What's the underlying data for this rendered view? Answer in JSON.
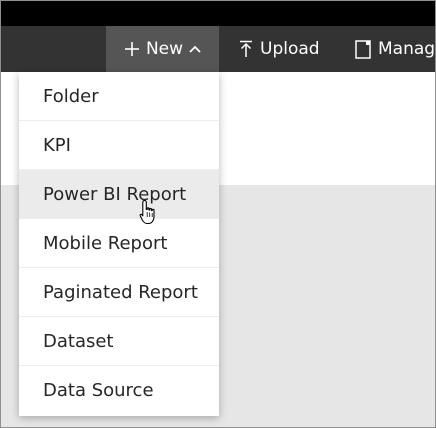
{
  "toolbar": {
    "new_label": "New",
    "upload_label": "Upload",
    "manage_label": "Manage"
  },
  "menu": {
    "items": [
      {
        "label": "Folder"
      },
      {
        "label": "KPI"
      },
      {
        "label": "Power BI Report",
        "hovered": true
      },
      {
        "label": "Mobile Report"
      },
      {
        "label": "Paginated Report"
      },
      {
        "label": "Dataset"
      },
      {
        "label": "Data Source"
      }
    ]
  },
  "colors": {
    "top_strip": "#000000",
    "toolbar_bg": "#333333",
    "new_button_bg": "#555555",
    "toolbar_text": "#ffffff",
    "menu_bg": "#ffffff",
    "menu_hover_bg": "#ebebeb",
    "menu_text": "#262626",
    "content_gray": "#e6e6e6"
  },
  "icons": {
    "new": "plus-icon",
    "new_toggle": "chevron-up-icon",
    "upload": "upload-icon",
    "manage": "document-icon",
    "pointer": "hand-cursor-icon"
  }
}
